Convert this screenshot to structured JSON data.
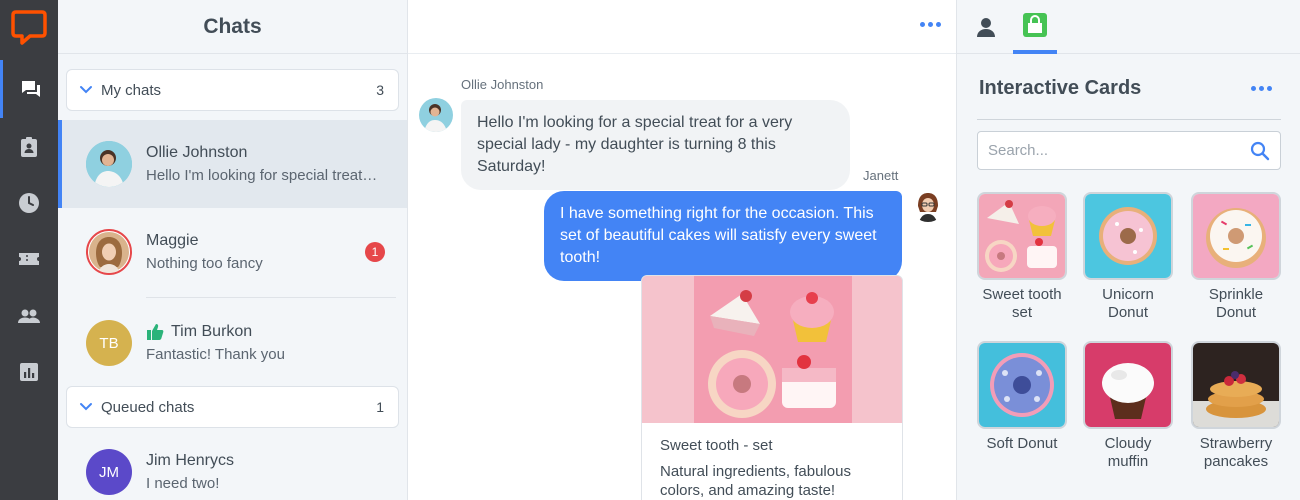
{
  "rail": {
    "items": [
      "chats-icon",
      "tickets-icon",
      "archives-icon",
      "tickets-coupon-icon",
      "agents-icon",
      "reports-icon"
    ],
    "accent": "#4384f5",
    "logo_color": "#ff5100"
  },
  "chats": {
    "title": "Chats",
    "my_chats": {
      "label": "My chats",
      "count": "3"
    },
    "queued_chats": {
      "label": "Queued chats",
      "count": "1"
    },
    "items": [
      {
        "name": "Ollie Johnston",
        "message": "Hello I'm looking for special treats for my daughter",
        "active": true
      },
      {
        "name": "Maggie",
        "message": "Nothing too fancy",
        "unread": "1"
      },
      {
        "name": "Tim Burkon",
        "initials": "TB",
        "message": "Fantastic! Thank you",
        "icon": "thumbs-up-icon"
      },
      {
        "name": "Jim Henrycs",
        "initials": "JM",
        "message": "I need two!"
      }
    ]
  },
  "conversation": {
    "messages": [
      {
        "sender": "Ollie Johnston",
        "text": "Hello I'm looking for a special treat for a very special lady - my daughter is turning 8 this Saturday!",
        "direction": "in"
      },
      {
        "sender": "Janett",
        "text": "I have something right for the occasion. This set of beautiful cakes will satisfy every sweet tooth!",
        "direction": "out"
      }
    ],
    "card": {
      "title": "Sweet tooth - set",
      "description": "Natural ingredients, fabulous colors, and amazing taste!"
    }
  },
  "panel": {
    "title": "Interactive Cards",
    "search_placeholder": "Search...",
    "cards": [
      {
        "label": "Sweet tooth set"
      },
      {
        "label": "Unicorn Donut"
      },
      {
        "label": "Sprinkle Donut"
      },
      {
        "label": "Soft Donut"
      },
      {
        "label": "Cloudy muffin"
      },
      {
        "label": "Strawberry pancakes"
      }
    ]
  }
}
